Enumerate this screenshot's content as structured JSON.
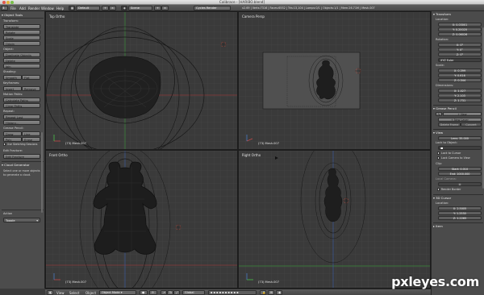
{
  "window": {
    "title": "Calibrace - [HARIBO.blend]"
  },
  "infobar": {
    "menu": [
      "File",
      "Add",
      "Render",
      "Window",
      "Help"
    ],
    "screen_layout": "Default",
    "scene": "Scene",
    "render_engine": "Cycles Render",
    "stats": "v2.69 | Verts:7316 | Faces:6552 | Tris:13,104 | Lamps:0/1 | Objects:1/1 | Mem:26.71M | Mesh.007"
  },
  "toolshelf": {
    "header": "Object Tools",
    "transform": {
      "label": "Transform:",
      "buttons": [
        "Translate",
        "Rotate",
        "Scale",
        "Origin"
      ]
    },
    "object": {
      "label": "Object:",
      "buttons": [
        "Duplicate Objects",
        "Delete",
        "Join"
      ]
    },
    "shading": {
      "label": "Shading:",
      "smooth": "Smooth",
      "flat": "Flat"
    },
    "keyframes": {
      "label": "Keyframes:",
      "insert": "Insert",
      "remove": "Remove"
    },
    "motion_paths": {
      "label": "Motion Paths:",
      "buttons": [
        "Calculate Paths",
        "Clear Paths"
      ]
    },
    "repeat": {
      "label": "Repeat:",
      "buttons": [
        "Repeat Last",
        "History..."
      ]
    },
    "grease_pencil": {
      "label": "Grease Pencil:",
      "draw": "Draw",
      "line": "Line",
      "poly": "Poly",
      "erase": "Erase",
      "use_sketching": "Use Sketching Sessions"
    },
    "edit_fracture": {
      "label": "Edit Fracture:",
      "button": "Edit Fracture"
    },
    "cloud_generator": {
      "header": "Cloud Generator",
      "text": "Select one or more objects to generate a cloud."
    },
    "action": {
      "label": "Action",
      "value": "Toggle"
    }
  },
  "viewports": {
    "top_left": {
      "title": "Top Ortho",
      "object_label": "(73) Mesh.007"
    },
    "top_right": {
      "title": "Camera Persp",
      "object_label": "(73) Mesh.007"
    },
    "bottom_left": {
      "title": "Front Ortho",
      "object_label": "(73) Mesh.007"
    },
    "bottom_right": {
      "title": "Right Ortho",
      "object_label": "(73) Mesh.007"
    }
  },
  "vpheader": {
    "menu": [
      "View",
      "Select",
      "Object"
    ],
    "mode": "Object Mode",
    "pivot": "Global"
  },
  "properties": {
    "transform": {
      "header": "Transform",
      "location_label": "Location:",
      "location": [
        "X: 0.03001",
        "Y: 0.20020",
        "Z: 0.06026"
      ],
      "rotation_label": "Rotation:",
      "rotation": [
        "X: 0°",
        "Y: 0°",
        "Z: 0°"
      ],
      "rotation_mode": "XYZ Euler",
      "scale_label": "Scale:",
      "scale": [
        "X: 0.399",
        "Y: 0.616",
        "Z: 0.344"
      ],
      "dimensions_label": "Dimensions:",
      "dimensions": [
        "X: 1.027",
        "Y: 2.103",
        "Z: 1.731"
      ]
    },
    "grease_pencil": {
      "header": "Grease Pencil",
      "new": "New",
      "new_layer": "New Layer",
      "delete_frame": "Delete Frame",
      "convert": "Convert"
    },
    "view": {
      "header": "View",
      "lens": "Lens: 35.000",
      "lock_to_object": "Lock to Object:",
      "lock_to_cursor": "Lock to Cursor",
      "lock_camera": "Lock Camera to View",
      "clip_label": "Clip:",
      "clip_start": "Start: 0.010",
      "clip_end": "End: 1000.000",
      "local_camera": "Local Camera:",
      "render_border": "Render Border"
    },
    "cursor": {
      "header": "3D Cursor",
      "location_label": "Location:",
      "location": [
        "X: 2.5005",
        "Y: 1.2530",
        "Z: 1.2265"
      ]
    },
    "item": {
      "header": "Item"
    }
  },
  "watermark": "pxleyes.com"
}
